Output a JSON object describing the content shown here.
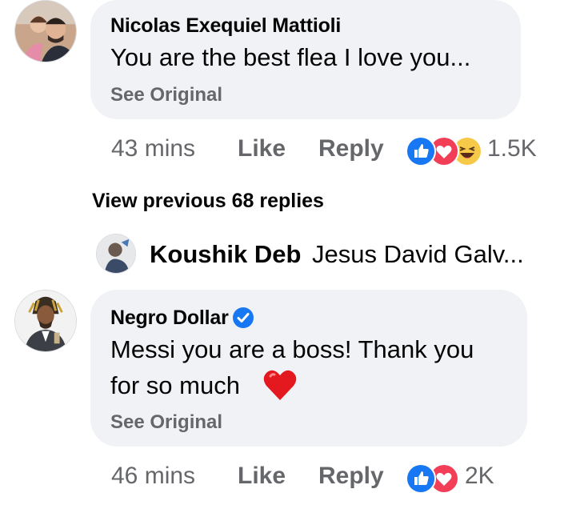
{
  "comments": [
    {
      "author": "Nicolas Exequiel Mattioli",
      "text_lines": [
        "You are the best flea I love you..."
      ],
      "see_original": "See Original",
      "time": "43 mins",
      "like": "Like",
      "reply": "Reply",
      "reactions": [
        "like-icon",
        "love-icon",
        "haha-icon"
      ],
      "reaction_count": "1.5K"
    },
    {
      "author": "Negro Dollar",
      "verified": true,
      "text_lines": [
        "Messi you are a boss! Thank you",
        "for so much"
      ],
      "emoji": "heart-emoji",
      "see_original": "See Original",
      "time": "46 mins",
      "like": "Like",
      "reply": "Reply",
      "reactions": [
        "like-icon",
        "love-icon"
      ],
      "reaction_count": "2K"
    }
  ],
  "view_previous": "View previous 68 replies",
  "reply_preview": {
    "name": "Koushik Deb",
    "snippet": "Jesus David Galv..."
  },
  "colors": {
    "bubble": "#f0f2f5",
    "text": "#050505",
    "secondary": "#65676b",
    "like_blue": "#1877f2",
    "love_red": "#f33e58",
    "verified_blue": "#1877f2"
  }
}
